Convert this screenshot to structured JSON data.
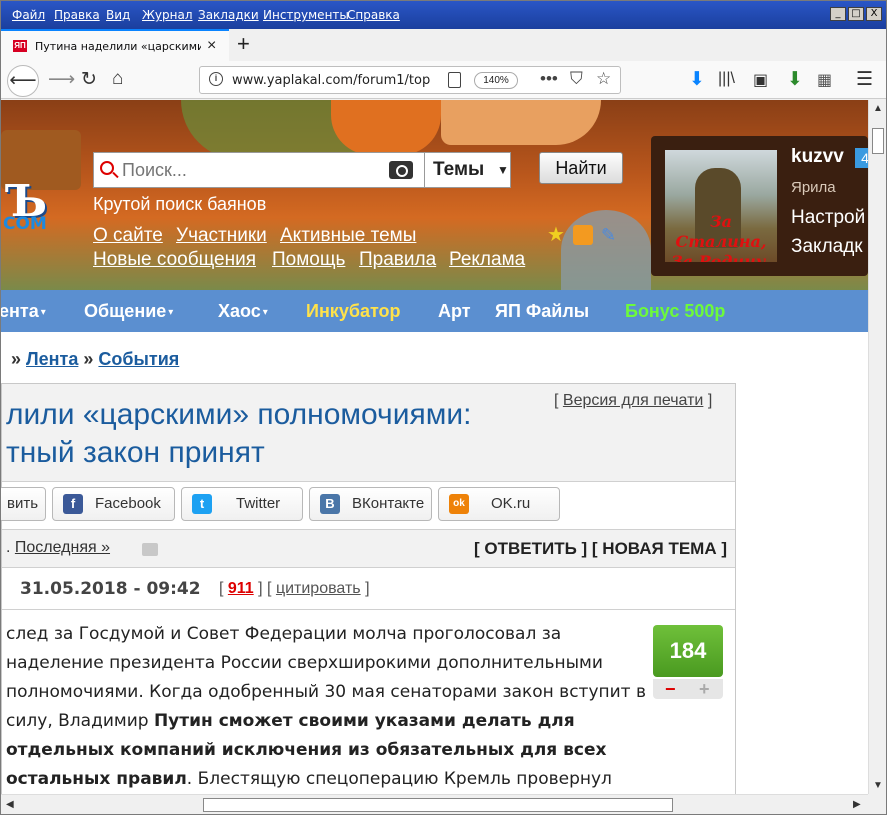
{
  "menu": [
    "Файл",
    "Правка",
    "Вид",
    "Журнал",
    "Закладки",
    "Инструменты",
    "Справка"
  ],
  "window_buttons": [
    "_",
    "□",
    "X"
  ],
  "tab": {
    "title": "Путина наделили «царскими» полн",
    "close": "×",
    "new": "+"
  },
  "nav": {
    "url": "www.yaplakal.com/forum1/top",
    "zoom": "140%"
  },
  "header": {
    "logo": "Ъ",
    "logo_com": "COM",
    "search_placeholder": "Поиск...",
    "search_scope": "Темы",
    "search_button": "Найти",
    "tagline": "Крутой поиск баянов",
    "links_row1": [
      "О сайте",
      "Участники",
      "Активные темы"
    ],
    "links_row2": [
      "Новые сообщения",
      "Помощь",
      "Правила",
      "Реклама"
    ]
  },
  "user": {
    "name": "kuzvv",
    "badge": "4",
    "rank": "Ярила",
    "avatar_text": "За Сталина, За Родину.",
    "links": [
      "Настрой",
      "Закладк"
    ]
  },
  "navstrip": [
    {
      "label": "ента",
      "arrow": "▾",
      "color": "#ffffff"
    },
    {
      "label": "Общение",
      "arrow": "▾",
      "color": "#ffffff"
    },
    {
      "label": "Хаос",
      "arrow": "▾",
      "color": "#ffffff"
    },
    {
      "label": "Инкубатор",
      "arrow": "",
      "color": "#ffe24a"
    },
    {
      "label": "Арт",
      "arrow": "",
      "color": "#ffffff"
    },
    {
      "label": "ЯП Файлы",
      "arrow": "",
      "color": "#ffffff"
    },
    {
      "label": "Бонус 500р",
      "arrow": "",
      "color": "#6dfa3a"
    }
  ],
  "breadcrumb": {
    "sep": "»",
    "items": [
      "Лента",
      "События"
    ]
  },
  "article": {
    "print_link": "Версия для печати",
    "title_line1": "лили «царскими» полномочиями:",
    "title_line2": "тный закон принят",
    "share": [
      {
        "label": "вить",
        "icon": "",
        "icon_color": ""
      },
      {
        "label": "Facebook",
        "icon": "f",
        "icon_color": "#3b5998"
      },
      {
        "label": "Twitter",
        "icon": "t",
        "icon_color": "#1da1f2"
      },
      {
        "label": "ВКонтакте",
        "icon": "В",
        "icon_color": "#4a76a8"
      },
      {
        "label": "OK.ru",
        "icon": "ok",
        "icon_color": "#ee8208"
      }
    ],
    "last_link": "Последняя »",
    "reply": "[ ОТВЕТИТЬ ] [ НОВАЯ ТЕМА ]",
    "post_date": "31.05.2018 - 09:42",
    "post_num": "911",
    "post_cite": "цитировать",
    "rating": "184",
    "rate_minus": "−",
    "rate_plus": "+",
    "body_parts": [
      "след за Госдумой и Совет Федерации молча проголосовал за наделение президента России сверхширокими дополнительными полномочиями. Когда одобренный 30 мая сенаторами закон вступит в силу, Владимир ",
      "Путин сможет своими указами делать для отдельных компаний исключения из обязательных для всех остальных правил",
      ". Блестящую спецоперацию Кремль провернул всего за"
    ]
  }
}
